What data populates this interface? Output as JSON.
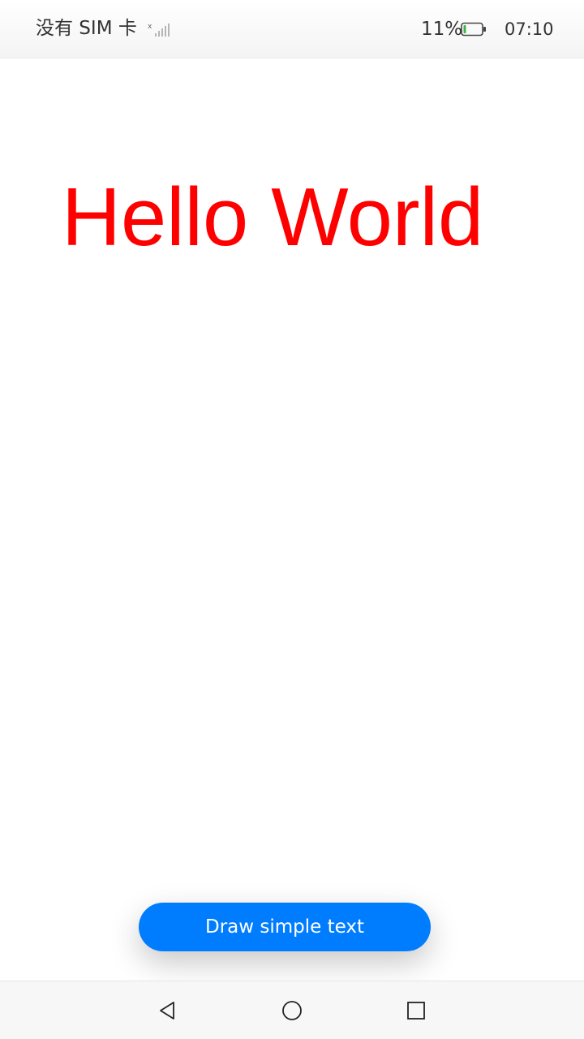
{
  "status_bar": {
    "carrier": "没有 SIM 卡",
    "signal_icon": "signal-no-sim-icon",
    "battery_percent": "11%",
    "battery_icon": "battery-low-icon",
    "time": "07:10"
  },
  "canvas": {
    "text": "Hello World",
    "text_color": "#ff0000"
  },
  "actions": {
    "draw_button_label": "Draw simple text",
    "button_color": "#007dff"
  },
  "nav_bar": {
    "back_icon": "back-triangle-icon",
    "home_icon": "home-circle-icon",
    "recent_icon": "recent-apps-square-icon"
  }
}
